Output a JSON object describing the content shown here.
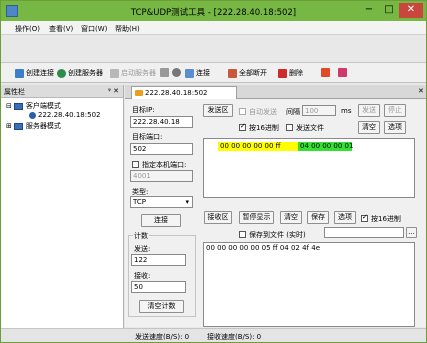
{
  "window": {
    "title": "TCP&UDP测试工具 - [222.28.40.18:502]",
    "min": "−",
    "max": "□",
    "close": "✕"
  },
  "menu": [
    "操作(O)",
    "查看(V)",
    "窗口(W)",
    "帮助(H)"
  ],
  "toolbar": {
    "create_conn": "创建连接",
    "create_server": "创建服务器",
    "start_server": "启动服务器",
    "connect": "连接",
    "disconnect_all": "全部断开",
    "delete": "删除"
  },
  "sidebar": {
    "title": "属性栏",
    "pin": "ᵠ ✕",
    "client_mode": "客户端模式",
    "client_entry": "222.28.40.18:502",
    "server_mode": "服务器模式"
  },
  "tab": {
    "label": "222.28.40.18:502",
    "close": "✕"
  },
  "conn": {
    "target_ip_label": "目标IP:",
    "target_ip": "222.28.40.18",
    "target_port_label": "目标端口:",
    "target_port": "502",
    "local_port_label": "指定本机端口:",
    "local_port": "4001",
    "type_label": "类型:",
    "type_value": "TCP",
    "connect_btn": "连接"
  },
  "counter": {
    "title": "计数",
    "send_label": "发送:",
    "send_value": "122",
    "recv_label": "接收:",
    "recv_value": "50",
    "clear_btn": "清空计数"
  },
  "send": {
    "area_btn": "发送区",
    "auto_send": "自动发送",
    "interval_label": "间隔",
    "interval_value": "100",
    "interval_unit": "ms",
    "send_btn": "发送",
    "stop_btn": "停止",
    "hex_label": "按16进制",
    "file_label": "发送文件",
    "clear_btn": "清空",
    "options_btn": "选项",
    "hex_part1": "00 00 00 00 00 ff",
    "hex_part2": "04 00 00 00 01"
  },
  "recv": {
    "area_btn": "接收区",
    "pause_btn": "暂停显示",
    "clear_btn": "清空",
    "save_btn": "保存",
    "options_btn": "选项",
    "hex_label": "按16进制",
    "save_file_label": "保存到文件 (实时)",
    "browse": "...",
    "data": "00 00 00 00 00 05 ff 04 02 4f 4e"
  },
  "status": {
    "send_speed": "发送速度(B/S): 0",
    "recv_speed": "接收速度(B/S): 0"
  },
  "colors": {
    "title_green": "#76b843",
    "hex_yellow": "#ffff00",
    "hex_green": "#33e033"
  }
}
